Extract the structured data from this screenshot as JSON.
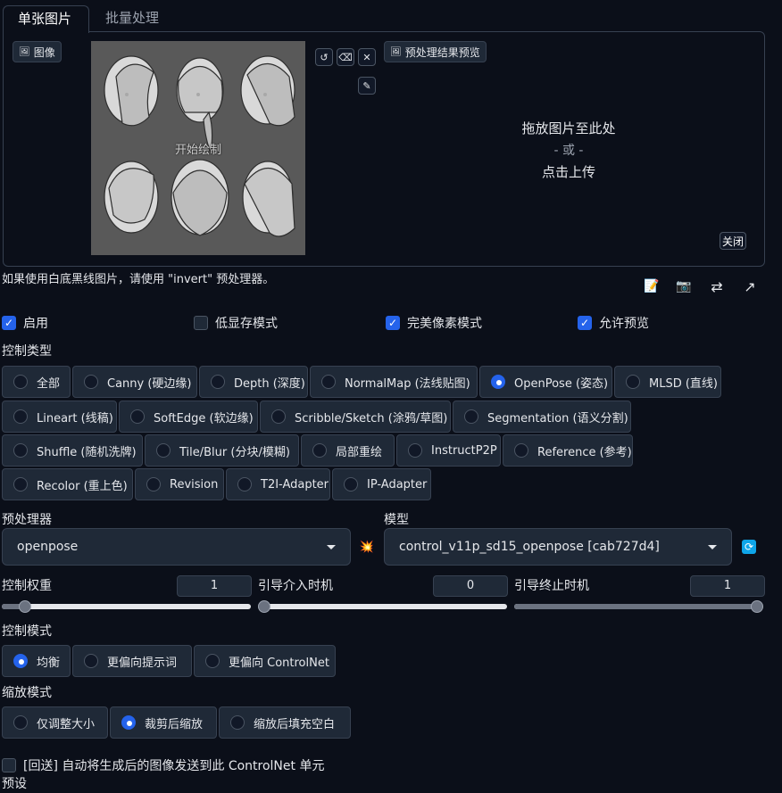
{
  "tabs": {
    "single": "单张图片",
    "batch": "批量处理"
  },
  "image_panel": {
    "image_label": "图像",
    "start_draw": "开始绘制",
    "preview_label": "预处理结果预览",
    "drop_line1": "拖放图片至此处",
    "drop_line2": "- 或 -",
    "drop_line3": "点击上传",
    "close": "关闭"
  },
  "hint": "如果使用白底黑线图片，请使用 \"invert\" 预处理器。",
  "checkboxes": {
    "enable": {
      "label": "启用",
      "checked": true
    },
    "low_vram": {
      "label": "低显存模式",
      "checked": false
    },
    "pixel_perfect": {
      "label": "完美像素模式",
      "checked": true
    },
    "allow_preview": {
      "label": "允许预览",
      "checked": true
    }
  },
  "control_type": {
    "title": "控制类型",
    "options": [
      "全部",
      "Canny (硬边缘)",
      "Depth (深度)",
      "NormalMap (法线贴图)",
      "OpenPose (姿态)",
      "MLSD (直线)",
      "Lineart (线稿)",
      "SoftEdge (软边缘)",
      "Scribble/Sketch (涂鸦/草图)",
      "Segmentation (语义分割)",
      "Shuffle (随机洗牌)",
      "Tile/Blur (分块/模糊)",
      "局部重绘",
      "InstructP2P",
      "Reference (参考)",
      "Recolor (重上色)",
      "Revision",
      "T2I-Adapter",
      "IP-Adapter"
    ],
    "selected": "OpenPose (姿态)"
  },
  "preprocessor": {
    "title": "预处理器",
    "value": "openpose"
  },
  "model": {
    "title": "模型",
    "value": "control_v11p_sd15_openpose [cab727d4]"
  },
  "sliders": {
    "weight": {
      "label": "控制权重",
      "value": "1",
      "fraction": 0.07
    },
    "start": {
      "label": "引导介入时机",
      "value": "0",
      "fraction": 0.0
    },
    "end": {
      "label": "引导终止时机",
      "value": "1",
      "fraction": 1.0
    }
  },
  "control_mode": {
    "title": "控制模式",
    "options": [
      "均衡",
      "更偏向提示词",
      "更偏向 ControlNet"
    ],
    "selected": "均衡"
  },
  "resize_mode": {
    "title": "缩放模式",
    "options": [
      "仅调整大小",
      "裁剪后缩放",
      "缩放后填充空白"
    ],
    "selected": "裁剪后缩放"
  },
  "loopback": {
    "label": "[回送] 自动将生成后的图像发送到此 ControlNet 单元",
    "checked": false
  },
  "presets_title": "预设",
  "colors": {
    "accent": "#2563eb",
    "bg": "#0b0f19",
    "panel": "#1f2937"
  },
  "icons": [
    "image-icon",
    "undo-icon",
    "eraser-icon",
    "close-icon",
    "brush-icon",
    "notes-icon",
    "camera-icon",
    "swap-icon",
    "send-icon",
    "explode-icon",
    "refresh-icon"
  ]
}
